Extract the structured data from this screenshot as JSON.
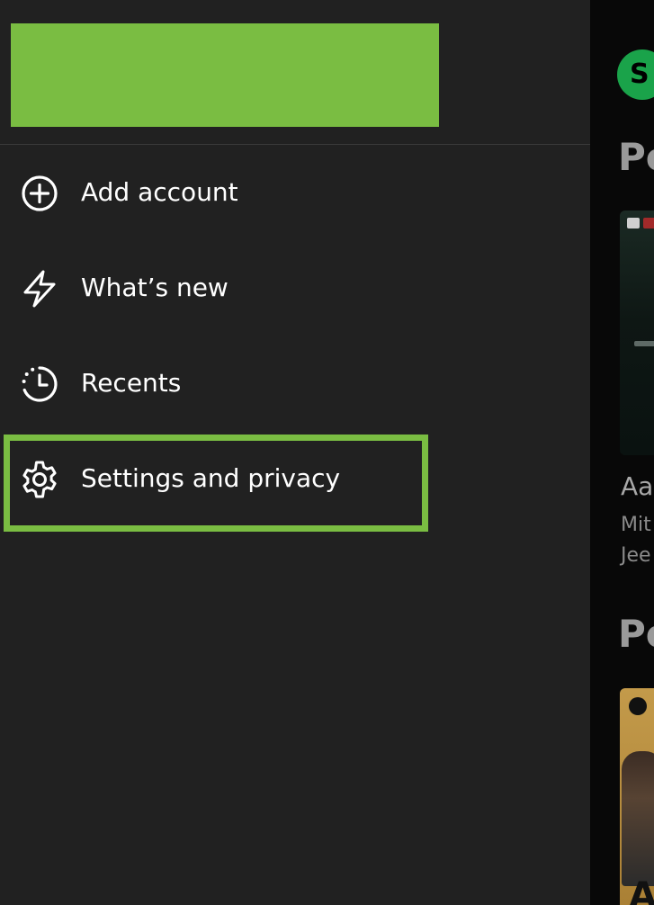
{
  "background_app": {
    "avatar_letter": "S",
    "section_heading_1": "Po",
    "card_title": "Aa",
    "card_subtitle_line1": "Mit",
    "card_subtitle_line2": "Jee",
    "section_heading_2": "Po",
    "card2_letter": "A"
  },
  "drawer": {
    "menu": [
      {
        "label": "Add account",
        "icon": "add-circle-icon"
      },
      {
        "label": "What’s new",
        "icon": "lightning-icon"
      },
      {
        "label": "Recents",
        "icon": "recents-clock-icon"
      },
      {
        "label": "Settings and privacy",
        "icon": "gear-icon"
      }
    ]
  },
  "colors": {
    "drawer_background": "#212121",
    "highlight_green": "#7abd42",
    "avatar_green": "#1aa34a",
    "text_primary": "#ffffff"
  }
}
